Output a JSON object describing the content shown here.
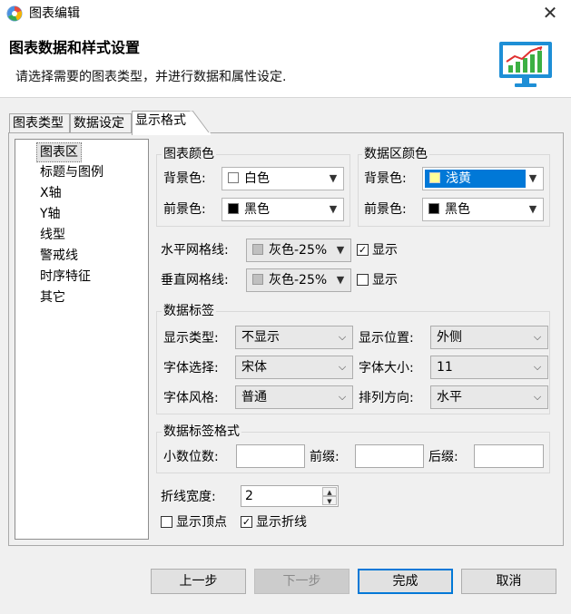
{
  "window": {
    "title": "图表编辑"
  },
  "header": {
    "title": "图表数据和样式设置",
    "description": "请选择需要的图表类型，并进行数据和属性设定."
  },
  "tabs": [
    {
      "label": "图表类型"
    },
    {
      "label": "数据设定"
    },
    {
      "label": "显示格式",
      "active": true
    }
  ],
  "tree": {
    "items": [
      "图表区",
      "标题与图例",
      "X轴",
      "Y轴",
      "线型",
      "警戒线",
      "时序特征",
      "其它"
    ],
    "selected": "图表区"
  },
  "chart_color": {
    "title": "图表颜色",
    "bg_label": "背景色:",
    "bg_value": "白色",
    "bg_swatch": "#ffffff",
    "fg_label": "前景色:",
    "fg_value": "黑色",
    "fg_swatch": "#000000"
  },
  "data_color": {
    "title": "数据区颜色",
    "bg_label": "背景色:",
    "bg_value": "浅黄",
    "bg_swatch": "#ffff99",
    "fg_label": "前景色:",
    "fg_value": "黑色",
    "fg_swatch": "#000000"
  },
  "grid": {
    "h_label": "水平网格线:",
    "h_value": "灰色-25%",
    "h_show_label": "显示",
    "h_show_checked": true,
    "v_label": "垂直网格线:",
    "v_value": "灰色-25%",
    "v_show_label": "显示",
    "v_show_checked": false,
    "swatch": "#c0c0c0"
  },
  "data_label": {
    "title": "数据标签",
    "type_label": "显示类型:",
    "type_value": "不显示",
    "position_label": "显示位置:",
    "position_value": "外侧",
    "font_label": "字体选择:",
    "font_value": "宋体",
    "size_label": "字体大小:",
    "size_value": "11",
    "style_label": "字体风格:",
    "style_value": "普通",
    "direction_label": "排列方向:",
    "direction_value": "水平"
  },
  "label_format": {
    "title": "数据标签格式",
    "decimals_label": "小数位数:",
    "decimals_value": "",
    "prefix_label": "前缀:",
    "prefix_value": "",
    "suffix_label": "后缀:",
    "suffix_value": ""
  },
  "line": {
    "width_label": "折线宽度:",
    "width_value": "2",
    "show_points_label": "显示顶点",
    "show_points_checked": false,
    "show_line_label": "显示折线",
    "show_line_checked": true
  },
  "buttons": {
    "prev": "上一步",
    "next": "下一步",
    "finish": "完成",
    "cancel": "取消"
  },
  "colors": {
    "accent": "#0078d7",
    "chart_icon_bar": "#3cb043",
    "chart_icon_line": "#e03030",
    "chart_icon_frame": "#1e8fd6"
  }
}
